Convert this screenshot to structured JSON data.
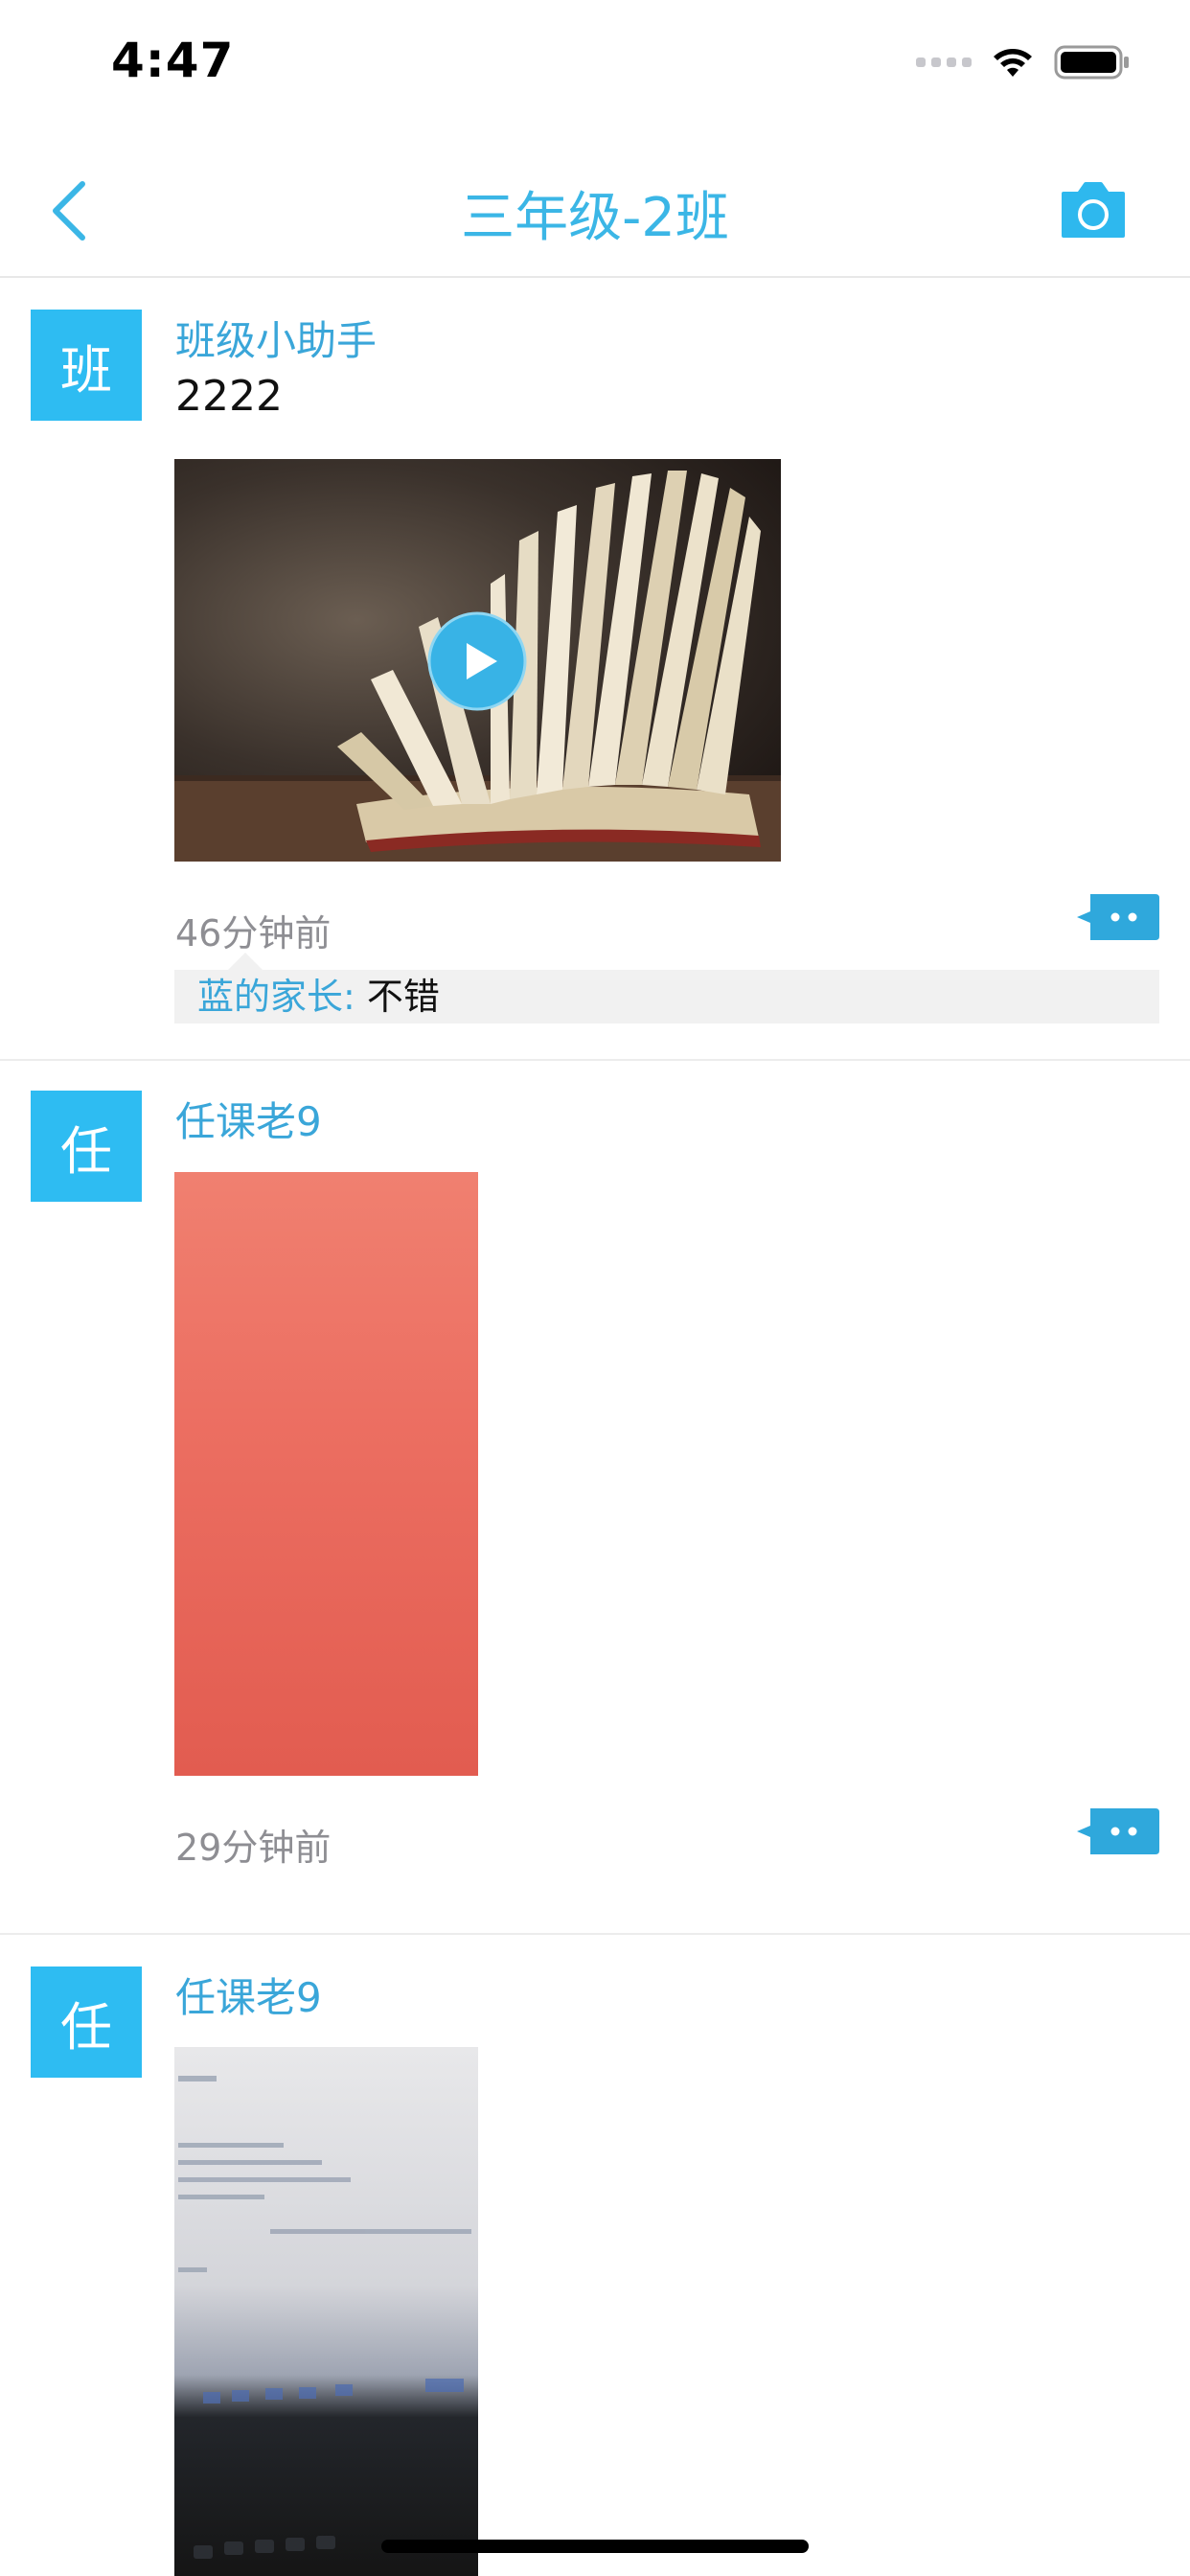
{
  "status_bar": {
    "time": "4:47"
  },
  "nav": {
    "title": "三年级-2班",
    "back_icon": "chevron-left-icon",
    "camera_icon": "camera-icon",
    "accent_color": "#3bb6e6"
  },
  "posts": [
    {
      "avatar_char": "班",
      "poster": "班级小助手",
      "text": "2222",
      "media": "video thumbnail",
      "time": "46分钟前",
      "comments": [
        {
          "author": "蓝的家长:",
          "text": "不错"
        }
      ]
    },
    {
      "avatar_char": "任",
      "poster": "任课老9",
      "media": "photo",
      "time": "29分钟前"
    },
    {
      "avatar_char": "任",
      "poster": "任课老9",
      "media": "photo"
    }
  ]
}
